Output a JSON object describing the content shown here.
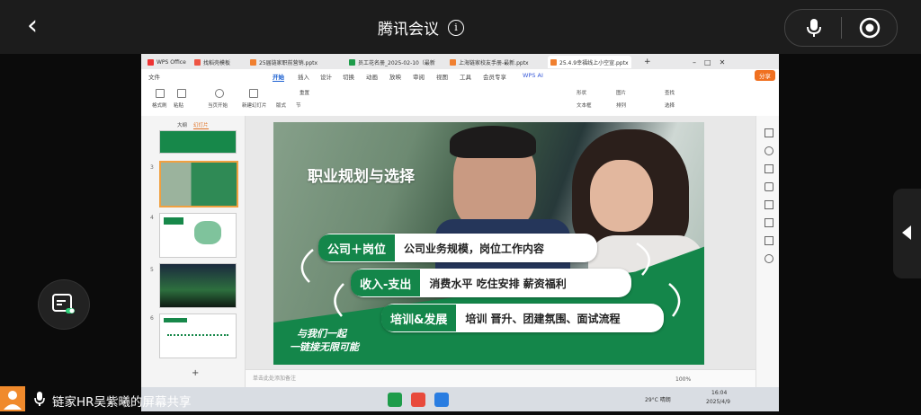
{
  "meeting": {
    "title": "腾讯会议",
    "back_icon": "chevron-left-icon",
    "info_icon": "info-icon",
    "mic_icon": "microphone-icon",
    "record_icon": "record-icon"
  },
  "wps": {
    "tabs": [
      {
        "label": "WPS Office",
        "icon_color": "#e33"
      },
      {
        "label": "找稻壳模板",
        "icon_color": "#e54"
      },
      {
        "label": "25届链家职前营销.pptx",
        "icon_color": "#f08030"
      },
      {
        "label": "员工花名册_2025-02-10（最新",
        "icon_color": "#1e9c4a"
      },
      {
        "label": "上海链家校友手册-最新.pptx",
        "icon_color": "#f08030"
      },
      {
        "label": "25.4.9幸福线上小空宣.pptx",
        "icon_color": "#f08030"
      }
    ],
    "menu": [
      "文件",
      "开始",
      "插入",
      "设计",
      "切换",
      "动画",
      "放映",
      "审阅",
      "视图",
      "工具",
      "会员专享",
      "WPS AI"
    ],
    "active_menu": "开始",
    "share_button": "分享",
    "toolbar": [
      "格式刷",
      "粘贴",
      "当页开始",
      "新建幻灯片",
      "版式",
      "节",
      "重置",
      "形状",
      "图片",
      "查找",
      "文本框",
      "排列",
      "选择"
    ],
    "pane_tabs": [
      "大纲",
      "幻灯片"
    ],
    "thumb_numbers": [
      "3",
      "4",
      "5",
      "6"
    ],
    "notes_placeholder": "单击此处添加备注",
    "add_slide": "+",
    "status": {
      "zoom": "100%",
      "weather": "29°C 晴朗",
      "time": "16:04",
      "date": "2025/4/9"
    }
  },
  "slide": {
    "title": "职业规划与选择",
    "rows": [
      {
        "label": "公司＋岗位",
        "text": "公司业务规模，岗位工作内容"
      },
      {
        "label": "收入-支出",
        "text": "消费水平 吃住安排 薪资福利"
      },
      {
        "label": "培训&发展",
        "text": "培训 晋升、团建氛围、面试流程"
      }
    ],
    "slogan1": "与我们一起",
    "slogan2": "一链接无限可能",
    "accent_color": "#14864a"
  },
  "screen_share": {
    "text": "链家HR吴紫曦的屏幕共享"
  }
}
